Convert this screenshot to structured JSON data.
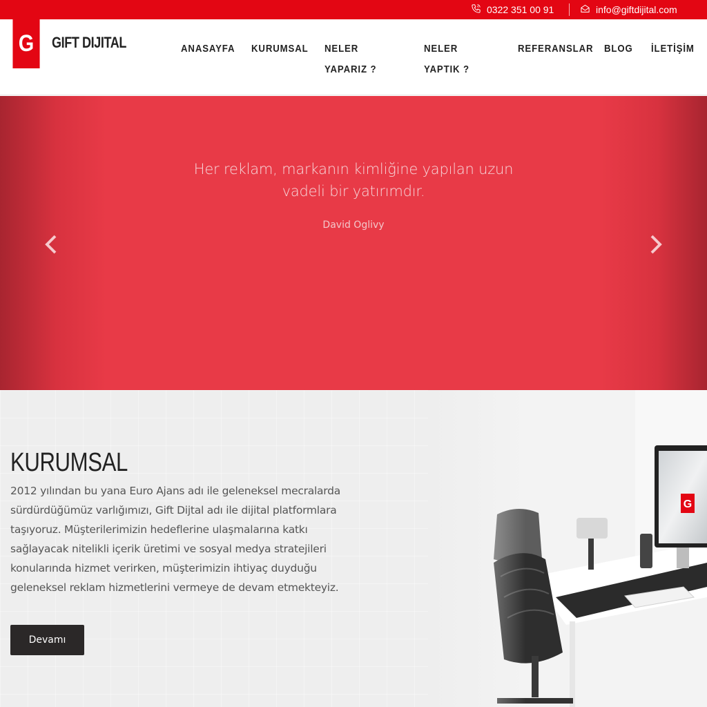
{
  "topbar": {
    "phone": "0322 351 00 91",
    "email": "info@giftdijital.com",
    "bg_color": "#e30613"
  },
  "brand": {
    "logo_letter": "G",
    "name": "GIFT DIJITAL",
    "color": "#e30613"
  },
  "nav": {
    "items": [
      {
        "label": "ANASAYFA"
      },
      {
        "label": "KURUMSAL"
      },
      {
        "label": "NELER YAPARIZ ?"
      },
      {
        "label": "NELER YAPTIK ?"
      },
      {
        "label": "REFERANSLAR"
      },
      {
        "label": "BLOG"
      },
      {
        "label": "İLETİŞİM"
      }
    ]
  },
  "hero": {
    "quote": "Her reklam, markanın kimliğine yapılan uzun vadeli bir yatırımdır.",
    "author": "David Oglivy",
    "prev_icon": "chevron-left-icon",
    "next_icon": "chevron-right-icon",
    "bg_color": "#e83a47"
  },
  "about": {
    "title": "KURUMSAL",
    "text": "2012 yılından bu yana Euro Ajans adı ile geleneksel mecralarda sürdürdüğümüz varlığımızı, Gift Dijtal adı ile dijital platformlara taşıyoruz. Müşterilerimizin hedeflerine ulaşmalarına katkı sağlayacak nitelikli içerik üretimi ve sosyal medya stratejileri konularında hizmet verirken, müşterimizin ihtiyaç duyduğu geleneksel reklam hizmetlerini vermeye de devam etmekteyiz.",
    "button_label": "Devamı",
    "monitor_logo_letter": "G"
  }
}
